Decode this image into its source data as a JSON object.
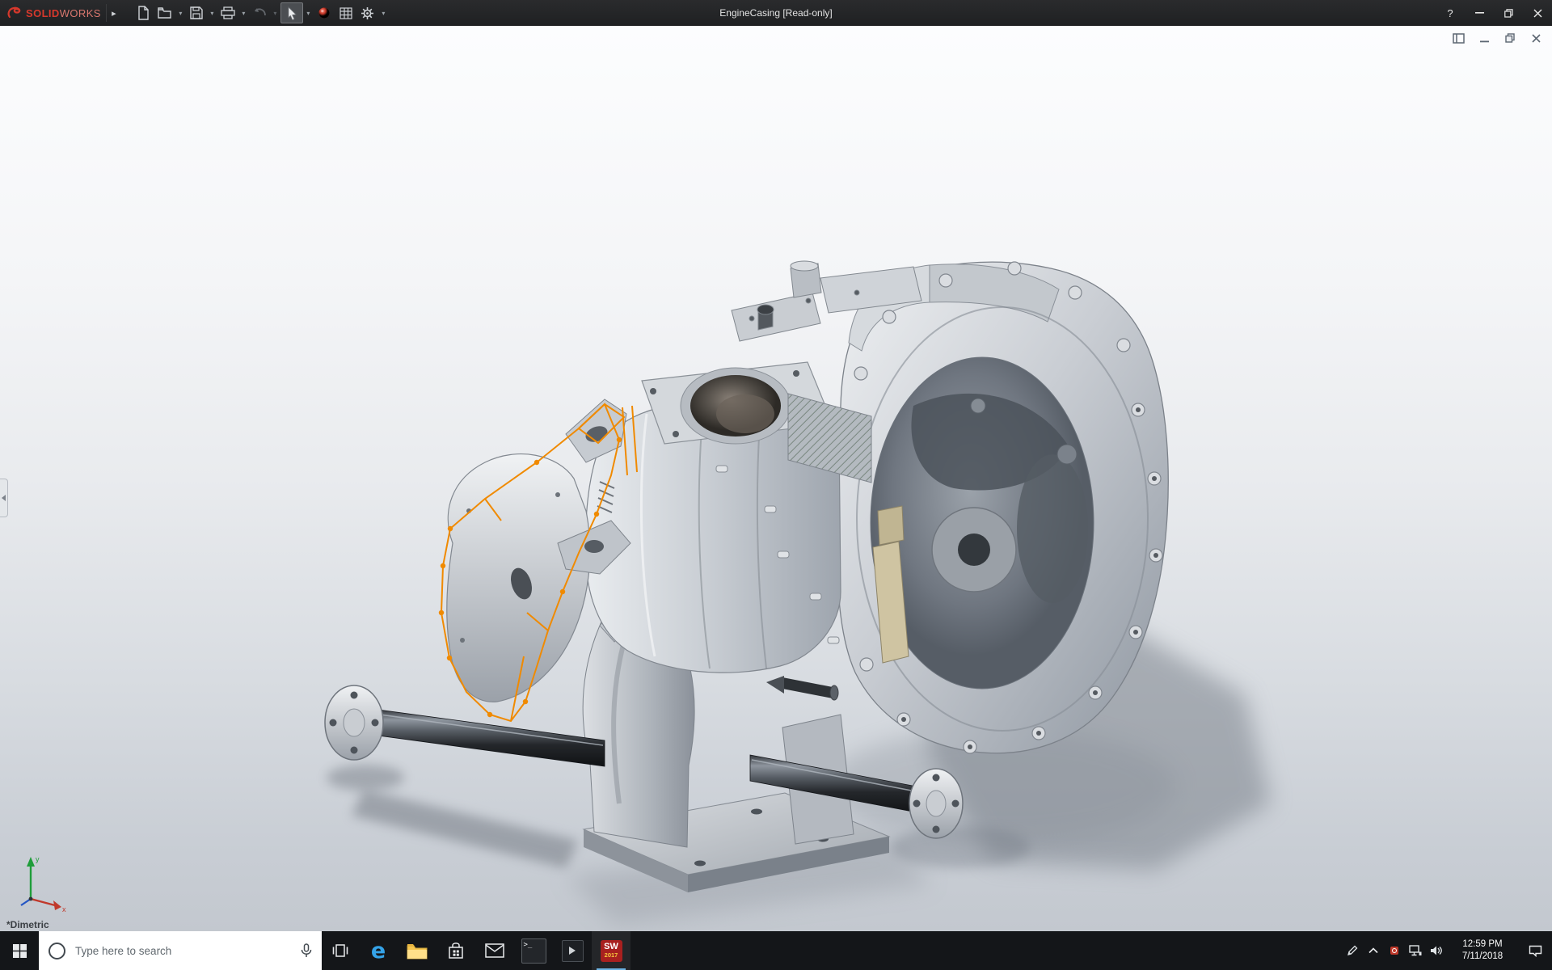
{
  "colors": {
    "brand_red": "#d6382c",
    "sketch_orange": "#f08a00",
    "titlebar_bg": "#242528",
    "taskbar_bg": "#141619",
    "running_indicator": "#6cb2e2",
    "viewport_gradient_top": "#fcfdfe",
    "viewport_gradient_bottom": "#c3c8cf"
  },
  "titlebar": {
    "brand_bold": "SOLID",
    "brand_light": "WORKS",
    "flyout_glyph": "▸",
    "document_title": "EngineCasing [Read-only]",
    "help_glyph": "?",
    "tools": [
      {
        "name": "new-document"
      },
      {
        "name": "open",
        "has_dropdown": true
      },
      {
        "name": "save",
        "has_dropdown": true
      },
      {
        "name": "print",
        "has_dropdown": true
      },
      {
        "name": "undo",
        "has_dropdown": true,
        "disabled": true
      },
      {
        "name": "select",
        "has_dropdown": true,
        "active": true
      },
      {
        "name": "appearances"
      },
      {
        "name": "design-table"
      },
      {
        "name": "options",
        "has_dropdown": true
      }
    ],
    "window_controls": [
      "help",
      "minimize",
      "restore",
      "close"
    ],
    "dropdown_glyph": "▾"
  },
  "document_window": {
    "controls": [
      "dock-pane",
      "minimize",
      "restore",
      "close"
    ]
  },
  "viewport": {
    "view_orientation_label": "*Dimetric",
    "selected_sketch_color": "#f08a00",
    "triad": {
      "x_label": "x",
      "y_label": "y"
    }
  },
  "taskbar": {
    "start": {
      "name": "start-button"
    },
    "search": {
      "placeholder": "Type here to search"
    },
    "apps": [
      {
        "name": "task-view"
      },
      {
        "name": "edge",
        "glyph": "e"
      },
      {
        "name": "file-explorer"
      },
      {
        "name": "store"
      },
      {
        "name": "mail"
      },
      {
        "name": "command-prompt",
        "glyph": ">_"
      },
      {
        "name": "media-player"
      },
      {
        "name": "solidworks",
        "glyph": "SW",
        "badge": "2017",
        "running": true
      }
    ],
    "tray": {
      "icons": [
        "pen",
        "hidden-icons-chevron",
        "solidworks-resource-monitor",
        "network",
        "volume"
      ],
      "time": "12:59 PM",
      "date": "7/11/2018",
      "action_center": "action-center"
    }
  }
}
